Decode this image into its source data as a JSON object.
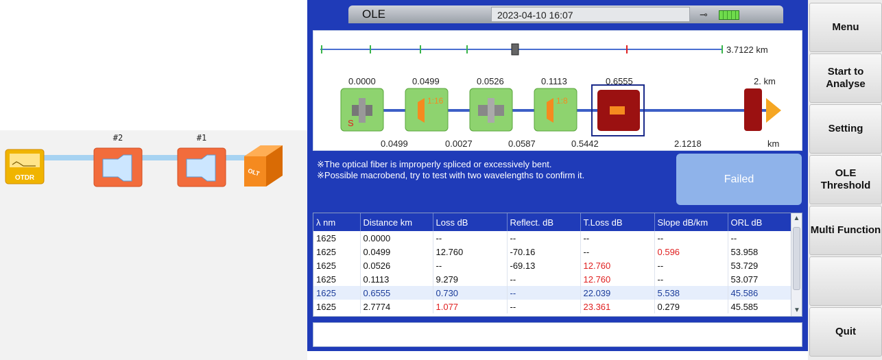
{
  "diagram": {
    "otdr_label": "OTDR",
    "olt_label": "OLT",
    "splitters": [
      {
        "label": "#2"
      },
      {
        "label": "#1"
      }
    ]
  },
  "header": {
    "title": "OLE",
    "datetime": "2023-04-10 16:07"
  },
  "trace": {
    "total_length": "3.7122 km",
    "event_positions": [
      "0.0000",
      "0.0499",
      "0.0526",
      "0.1113",
      "0.6555",
      "2. km"
    ],
    "segment_lengths": [
      "0.0499",
      "0.0027",
      "0.0587",
      "0.5442",
      "2.1218",
      "km"
    ],
    "ratio_1": "1:16",
    "ratio_2": "1:8",
    "start_marker": "S"
  },
  "messages": [
    "※The optical fiber is improperly spliced or excessively bent.",
    "※Possible macrobend, try to test with two wavelengths to confirm it."
  ],
  "result": "Failed",
  "table": {
    "headers": [
      "λ nm",
      "Distance km",
      "Loss dB",
      "Reflect. dB",
      "T.Loss dB",
      "Slope dB/km",
      "ORL dB"
    ],
    "rows": [
      [
        "1625",
        "0.0000",
        "--",
        "--",
        "--",
        "--",
        "--"
      ],
      [
        "1625",
        "0.0499",
        "12.760",
        "-70.16",
        "--",
        "0.596",
        "53.958"
      ],
      [
        "1625",
        "0.0526",
        "--",
        "-69.13",
        "12.760",
        "--",
        "53.729"
      ],
      [
        "1625",
        "0.1113",
        "9.279",
        "--",
        "12.760",
        "--",
        "53.077"
      ],
      [
        "1625",
        "0.6555",
        "0.730",
        "--",
        "22.039",
        "5.538",
        "45.586"
      ],
      [
        "1625",
        "2.7774",
        "1.077",
        "--",
        "23.361",
        "0.279",
        "45.585"
      ]
    ]
  },
  "menu": {
    "menu": "Menu",
    "start": "Start to Analyse",
    "setting": "Setting",
    "threshold": "OLE Threshold",
    "multi": "Multi Function",
    "empty": "",
    "quit": "Quit"
  },
  "colors": {
    "screen_bg": "#1f3bb8",
    "fault_red": "#e02020",
    "failed_bg": "#8fb3ea"
  }
}
